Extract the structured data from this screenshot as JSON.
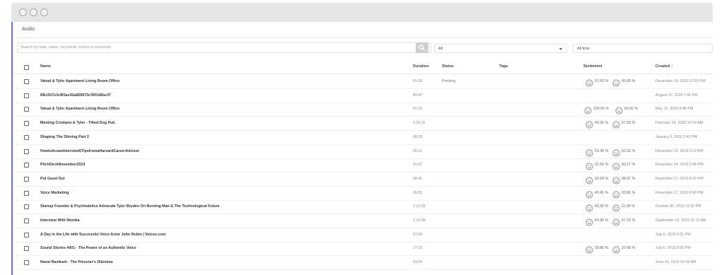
{
  "window": {
    "traffic_lights": [
      "window-close",
      "window-minimize",
      "window-zoom"
    ]
  },
  "page": {
    "title": "Audio",
    "search_placeholder": "Search by tags, name, keywords, topics or transcript",
    "search_icon": "magnifier-icon",
    "filter_status": "All",
    "filter_time": "All time"
  },
  "columns": {
    "name": "Name",
    "duration": "Duration",
    "status": "Status",
    "tags": "Tags",
    "sentiment": "Sentiment",
    "created": "Created ↓"
  },
  "rows": [
    {
      "name": "Vatsal & Tyler Apartment Living Room Office",
      "duration": "01:26",
      "status": "Pending",
      "tags": "",
      "pos": "07.69 %",
      "neg": "00.00 %",
      "created": "December 10, 2020 12:59 PM"
    },
    {
      "name": "REc557e3c8f2ac42a828973c39f1d6be37",
      "duration": "00:47",
      "status": "",
      "tags": "",
      "pos": "",
      "neg": "",
      "created": "August 22, 2020 7:05 PM"
    },
    {
      "name": "Vatsal & Tyler Apartment Living Room Office",
      "duration": "01:26",
      "status": "",
      "tags": "",
      "pos": "100.00 %",
      "neg": "00.00 %",
      "created": "May 13, 2020 9:48 PM"
    },
    {
      "name": "Meeting Cristiano & Tyler - Tilted Dog Pub",
      "duration": "1:05:11",
      "status": "",
      "tags": "",
      "pos": "49.36 %",
      "neg": "07.93 %",
      "created": "February 15, 2020 10:14 AM"
    },
    {
      "name": "Shaping The Shining Part 2",
      "duration": "08:16",
      "status": "",
      "tags": "",
      "pos": "",
      "neg": "",
      "created": "January 3, 2020 2:41 PM"
    },
    {
      "name": "HowtoAceanInterview5TipsfromaHarvardCareerAdvisor",
      "duration": "05:11",
      "status": "",
      "tags": "",
      "pos": "53.49 %",
      "neg": "02.33 %",
      "created": "December 23, 2019 9:13 PM"
    },
    {
      "name": "PitchDeckNovember2019",
      "duration": "31:07",
      "status": "",
      "tags": "",
      "pos": "31.50 %",
      "neg": "03.17 %",
      "created": "November 24, 2019 2:45 PM"
    },
    {
      "name": "Put Good Out",
      "duration": "08:41",
      "status": "",
      "tags": "",
      "pos": "32.69 %",
      "neg": "08.97 %",
      "created": "November 17, 2019 8:10 PM"
    },
    {
      "name": "Voice Marketing",
      "duration": "06:01",
      "status": "",
      "tags": "",
      "pos": "45.45 %",
      "neg": "03.90 %",
      "created": "November 17, 2019 6:43 PM"
    },
    {
      "name": "Startup Founder & Psychedelics Advocate Tyler Bryden On Burning Man & The Technological Future",
      "duration": "1:12:26",
      "status": "",
      "tags": "",
      "pos": "65.30 %",
      "neg": "11.99 %",
      "created": "October 30, 2019 11:52 PM"
    },
    {
      "name": "Interview With Monika",
      "duration": "1:12:09",
      "status": "",
      "tags": "",
      "pos": "64.30 %",
      "neg": "07.10 %",
      "created": "September 15, 2019 11:12 AM"
    },
    {
      "name": "A Day in the Life with Successful Voice Actor John Rubin | Voices.com",
      "duration": "52:59",
      "status": "",
      "tags": "",
      "pos": "",
      "neg": "",
      "created": "July 6, 2019 9:31 PM"
    },
    {
      "name": "Sound Stories #001 - The Power of an Authentic Voice",
      "duration": "27:16",
      "status": "",
      "tags": "",
      "pos": "39.86 %",
      "neg": "10.68 %",
      "created": "July 6, 2019 9:09 PM"
    },
    {
      "name": "Naval Ravikant - The Prisoner's Dilemma",
      "duration": "03:54",
      "status": "",
      "tags": "",
      "pos": "",
      "neg": "",
      "created": "June 14, 2019 10:39 AM"
    }
  ],
  "sentiment_icons": {
    "positive": "smiley-face-icon",
    "negative": "frown-face-icon"
  },
  "colors": {
    "accent": "#6f6fd0",
    "titlebar": "#e6e6e6"
  }
}
